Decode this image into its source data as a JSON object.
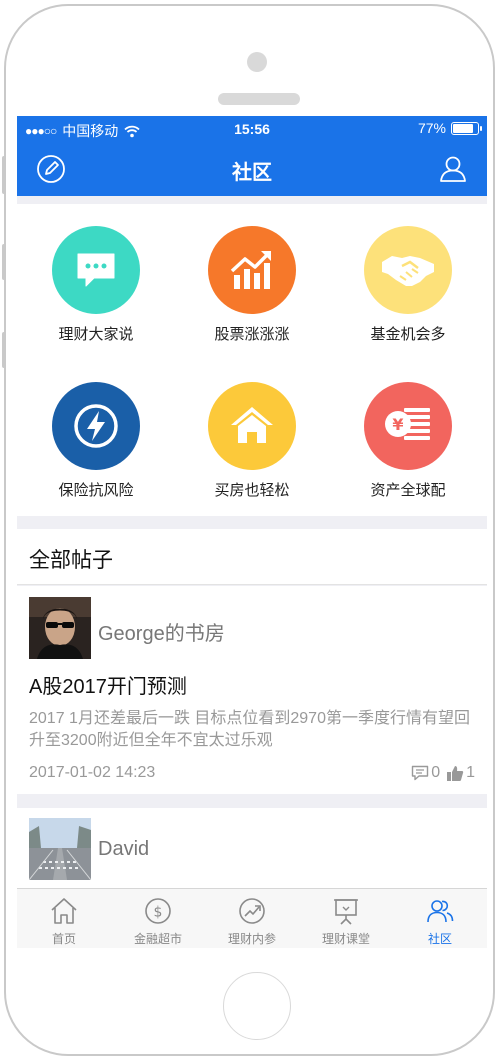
{
  "status_bar": {
    "signal_dots": "●●●○○",
    "carrier": "中国移动",
    "time": "15:56",
    "battery": "77%",
    "battery_level": 0.77
  },
  "header": {
    "title": "社区",
    "left_icon": "compose-icon",
    "right_icon": "user-icon",
    "color": "#1a73e8"
  },
  "categories": [
    {
      "label": "理财大家说",
      "icon": "chat-bubble-icon",
      "color": "#3dd9c4"
    },
    {
      "label": "股票涨涨涨",
      "icon": "rising-chart-icon",
      "color": "#f6782a"
    },
    {
      "label": "基金机会多",
      "icon": "handshake-icon",
      "color": "#fde17a"
    },
    {
      "label": "保险抗风险",
      "icon": "lightning-icon",
      "color": "#1a5fa8"
    },
    {
      "label": "买房也轻松",
      "icon": "house-icon",
      "color": "#fcc93a"
    },
    {
      "label": "资产全球配",
      "icon": "yen-coin-icon",
      "color": "#f2655e"
    }
  ],
  "posts_section": {
    "title": "全部帖子"
  },
  "posts": [
    {
      "author": "George的书房",
      "title": "A股2017开门预测",
      "excerpt": "2017 1月还差最后一跌 目标点位看到2970第一季度行情有望回升至3200附近但全年不宜太过乐观",
      "time": "2017-01-02 14:23",
      "comments": "0",
      "likes": "1"
    },
    {
      "author": "David"
    }
  ],
  "tabs": [
    {
      "label": "首页",
      "icon": "home-icon",
      "active": false
    },
    {
      "label": "金融超市",
      "icon": "dollar-coin-icon",
      "active": false
    },
    {
      "label": "理财内参",
      "icon": "trend-icon",
      "active": false
    },
    {
      "label": "理财课堂",
      "icon": "presentation-icon",
      "active": false
    },
    {
      "label": "社区",
      "icon": "community-icon",
      "active": true
    }
  ]
}
